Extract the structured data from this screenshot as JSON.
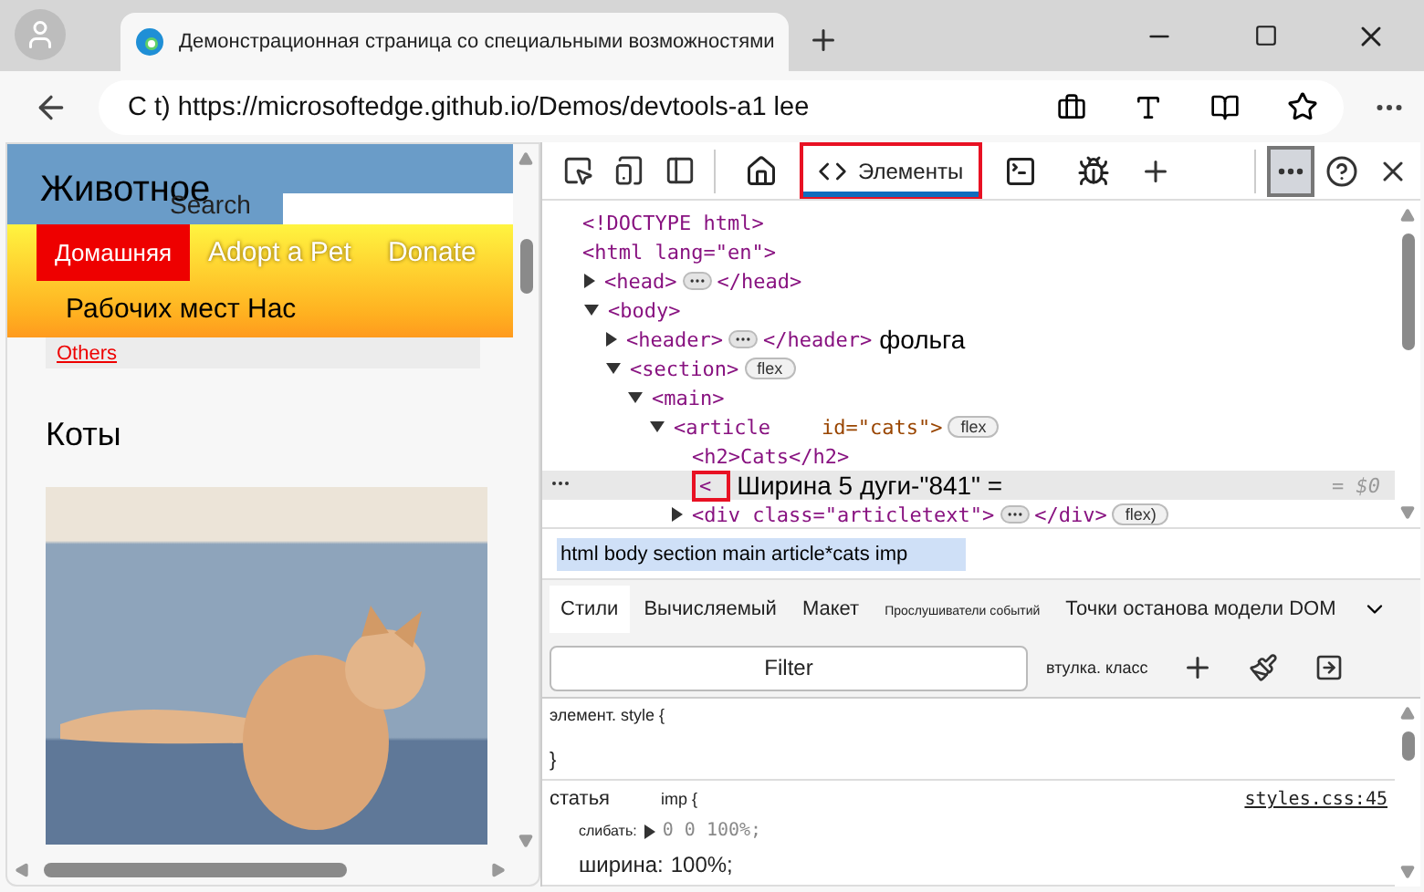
{
  "browser": {
    "tab_title": "Демонстрационная страница со специальными возможностями",
    "address": "C t) https://microsoftedge.github.io/Demos/devtools-a1 lee"
  },
  "page": {
    "title": "Животное",
    "search_placeholder": "Search",
    "nav": [
      {
        "label": "Домашняя",
        "selected": true
      },
      {
        "label": "Adopt a Pet",
        "selected": false
      },
      {
        "label": "Donate",
        "selected": false
      },
      {
        "label": "Рабочих мест Нас",
        "selected": false
      }
    ],
    "others_link": "Others",
    "heading": "Коты"
  },
  "devtools": {
    "tabs": [
      {
        "kind": "home",
        "selected": false
      },
      {
        "kind": "elements",
        "label": "Элементы",
        "selected": true,
        "highlighted": true
      },
      {
        "kind": "console",
        "selected": false
      },
      {
        "kind": "debug",
        "selected": false
      }
    ],
    "more_selected": true,
    "dom_tree": [
      {
        "tag": "<!DOCTYPE html>",
        "selected": false
      },
      {
        "tag": "<html lang=\"en\">",
        "selected": false,
        "children": [
          {
            "tag": "<head>",
            "expanded": false,
            "collapsed_marker": true,
            "closing": "</head>",
            "selected": false
          },
          {
            "tag": "<body>",
            "expanded": true,
            "selected": false,
            "children": [
              {
                "tag": "<header>",
                "expanded": false,
                "collapsed_marker": true,
                "closing": "</header>",
                "note": "фольга",
                "selected": false
              },
              {
                "tag": "<section>",
                "expanded": true,
                "badge": "flex",
                "selected": false,
                "children": [
                  {
                    "tag": "<main>",
                    "expanded": true,
                    "selected": false,
                    "children": [
                      {
                        "tag": "<article",
                        "attr": "id=\"cats\">",
                        "expanded": true,
                        "badge": "flex",
                        "selected": false,
                        "children": [
                          {
                            "tag": "<h2>Cats</h2>",
                            "selected": false
                          },
                          {
                            "tag": "<",
                            "highlighted": true,
                            "note": "Ширина 5 дуги-\"841\" =",
                            "suffix": "= $0",
                            "selected": true
                          },
                          {
                            "tag": "<div class=\"articletext\">",
                            "expanded": false,
                            "collapsed_marker": true,
                            "closing": "</div>",
                            "badge": "flex)",
                            "selected": false
                          }
                        ]
                      }
                    ]
                  }
                ]
              }
            ]
          }
        ]
      }
    ],
    "breadcrumb": "html body section main article*cats imp",
    "style_tabs": [
      {
        "label": "Стили",
        "selected": true,
        "kind": "normal"
      },
      {
        "label": "Вычисляемый",
        "selected": false,
        "kind": "normal"
      },
      {
        "label": "Макет",
        "selected": false,
        "kind": "normal"
      },
      {
        "label": "Прослушиватели событий",
        "selected": false,
        "kind": "compact"
      },
      {
        "label": "Точки останова модели DOM",
        "selected": false,
        "kind": "normal"
      }
    ],
    "filter_placeholder": "Filter",
    "hov_cls": "втулка. класс",
    "rules": [
      {
        "selector": "элемент. style {",
        "close": "}"
      },
      {
        "selector": "статья",
        "extra": "imp {",
        "source": "styles.css:45",
        "properties": [
          {
            "name": "слибать:",
            "value": "0 0 100%;",
            "kind": "shorthand"
          },
          {
            "name": "ширина:",
            "value": "100%;",
            "kind": "plain"
          }
        ]
      }
    ]
  }
}
